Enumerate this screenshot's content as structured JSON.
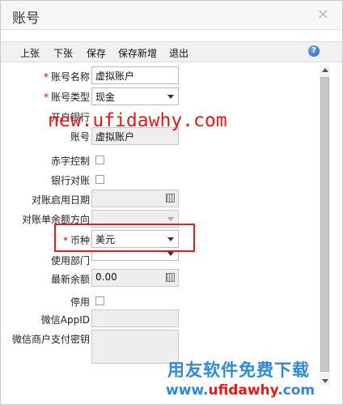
{
  "window": {
    "title": "账号",
    "close_glyph": "×"
  },
  "toolbar": {
    "prev": "上张",
    "next": "下张",
    "save": "保存",
    "save_new": "保存新增",
    "exit": "退出",
    "help_icon": "help-icon",
    "help_glyph": "?"
  },
  "form": {
    "account_name": {
      "label": "账号名称",
      "required_mark": "*",
      "value": "虚拟账户"
    },
    "account_type": {
      "label": "账号类型",
      "required_mark": "*",
      "value": "现金"
    },
    "bank": {
      "label": "开户银行",
      "value": ""
    },
    "account_no": {
      "label": "账号",
      "value": "虚拟账户"
    },
    "red_control": {
      "label": "赤字控制",
      "checked": false
    },
    "bank_reconcile": {
      "label": "银行对账",
      "checked": false
    },
    "reconcile_start_date": {
      "label": "对账启用日期",
      "value": ""
    },
    "statement_direction": {
      "label": "对账单余额方向",
      "value": ""
    },
    "currency": {
      "label": "币种",
      "required_mark": "*",
      "value": "美元"
    },
    "department": {
      "label": "使用部门",
      "value": ""
    },
    "latest_balance": {
      "label": "最新余额",
      "value": "0.00"
    },
    "disabled": {
      "label": "停用",
      "checked": false
    },
    "wechat_appid": {
      "label": "微信AppID",
      "value": ""
    },
    "wechat_secret": {
      "label": "微信商户支付密钥",
      "value": ""
    }
  },
  "watermark": {
    "url": "new.ufidawhy.com",
    "brand": "用友软件免费下载",
    "url2_prefix": "www.",
    "url2_main": "ufidawhy",
    "url2_suffix": ".com"
  },
  "colors": {
    "highlight": "#e02020",
    "required": "#d0021b",
    "watermark_red": "#e81818",
    "watermark_blue": "#2f88d8"
  }
}
